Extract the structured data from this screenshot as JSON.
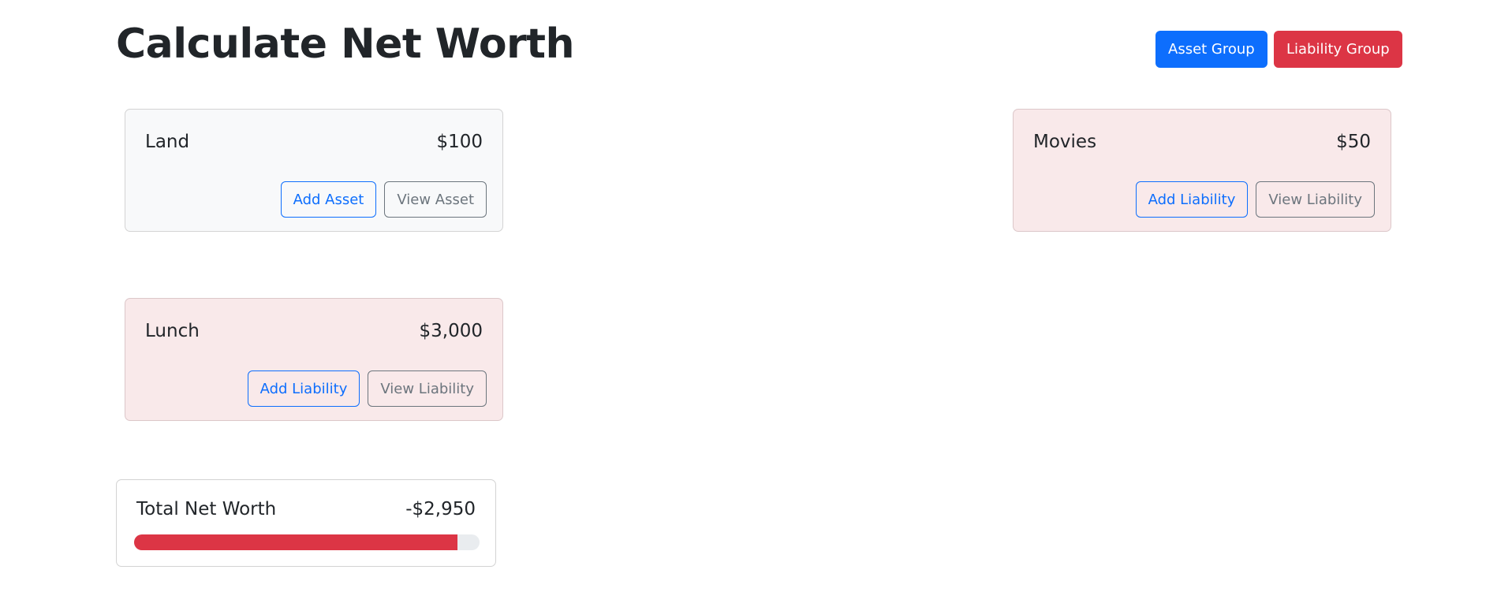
{
  "header": {
    "title": "Calculate Net Worth",
    "asset_group_label": "Asset Group",
    "liability_group_label": "Liability Group"
  },
  "colors": {
    "primary": "#0d6efd",
    "danger": "#dc3545",
    "secondary": "#6c757d",
    "asset_card_bg": "#f8f9fa",
    "liability_card_bg": "#f9e9ea"
  },
  "cards": [
    {
      "type": "asset",
      "name": "Land",
      "value": "$100",
      "add_label": "Add Asset",
      "view_label": "View Asset"
    },
    {
      "type": "liability",
      "name": "Movies",
      "value": "$50",
      "add_label": "Add Liability",
      "view_label": "View Liability"
    },
    {
      "type": "liability",
      "name": "Lunch",
      "value": "$3,000",
      "add_label": "Add Liability",
      "view_label": "View Liability"
    }
  ],
  "total": {
    "label": "Total Net Worth",
    "amount": "-$2,950",
    "progress_percent": 93.65,
    "progress_color": "#dc3545"
  }
}
